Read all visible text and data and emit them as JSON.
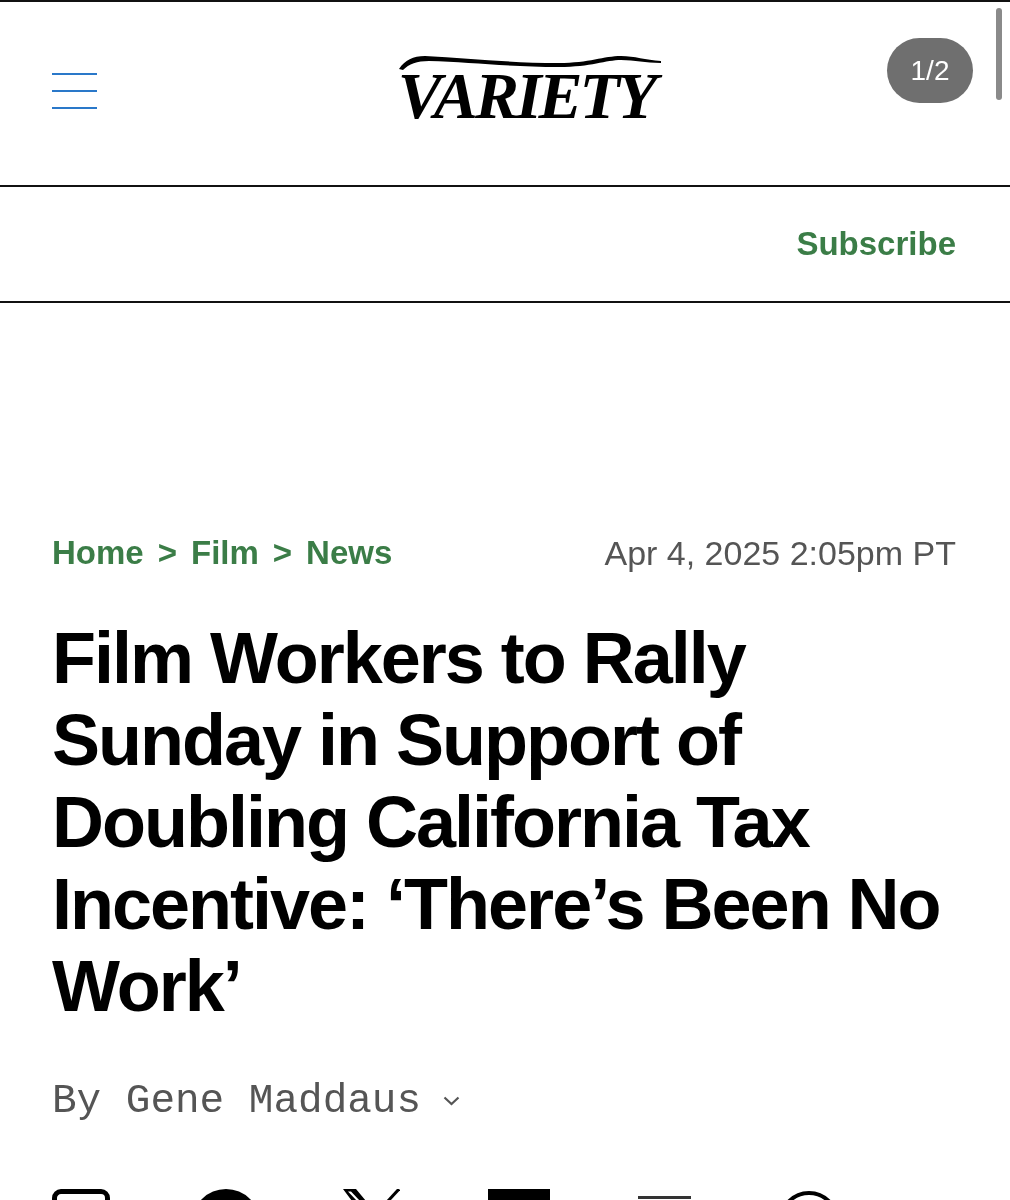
{
  "header": {
    "logo": "VARIETY",
    "page_counter": "1/2"
  },
  "subscribe_bar": {
    "link": "Subscribe"
  },
  "article": {
    "breadcrumbs": [
      {
        "label": "Home",
        "separator": ">"
      },
      {
        "label": "Film",
        "separator": ">"
      },
      {
        "label": "News"
      }
    ],
    "date": "Apr 4, 2025 2:05pm PT",
    "headline": "Film Workers to Rally Sunday in Support of Doubling California Tax Incentive: ‘There’s Been No Work’",
    "byline": {
      "prefix": "By",
      "author": "Gene Maddaus",
      "expanded": false
    }
  }
}
